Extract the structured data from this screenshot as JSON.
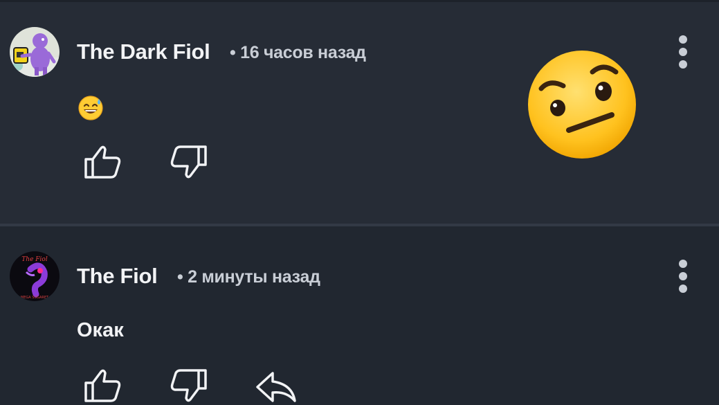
{
  "comments": [
    {
      "author": "The Dark Fiol",
      "timestamp": "• 16 часов назад",
      "body_emoji": "sweat-smile-emoji",
      "avatar": "purple-character-avatar"
    },
    {
      "author": "The Fiol",
      "timestamp": "• 2 минуты назад",
      "body_text": "Окак",
      "avatar": "dark-purple-character-avatar",
      "avatar_text_top": "The Fiol",
      "avatar_text_bottom": "MEGA SUGARET"
    }
  ],
  "overlay": {
    "emoji": "raised-eyebrow-emoji"
  },
  "colors": {
    "background": "#262c36",
    "background_alt": "#212730",
    "text": "#f2f3f5",
    "muted": "#c9ced6"
  },
  "icons": [
    "thumbs-up-icon",
    "thumbs-down-icon",
    "reply-icon",
    "more-vertical-icon"
  ]
}
